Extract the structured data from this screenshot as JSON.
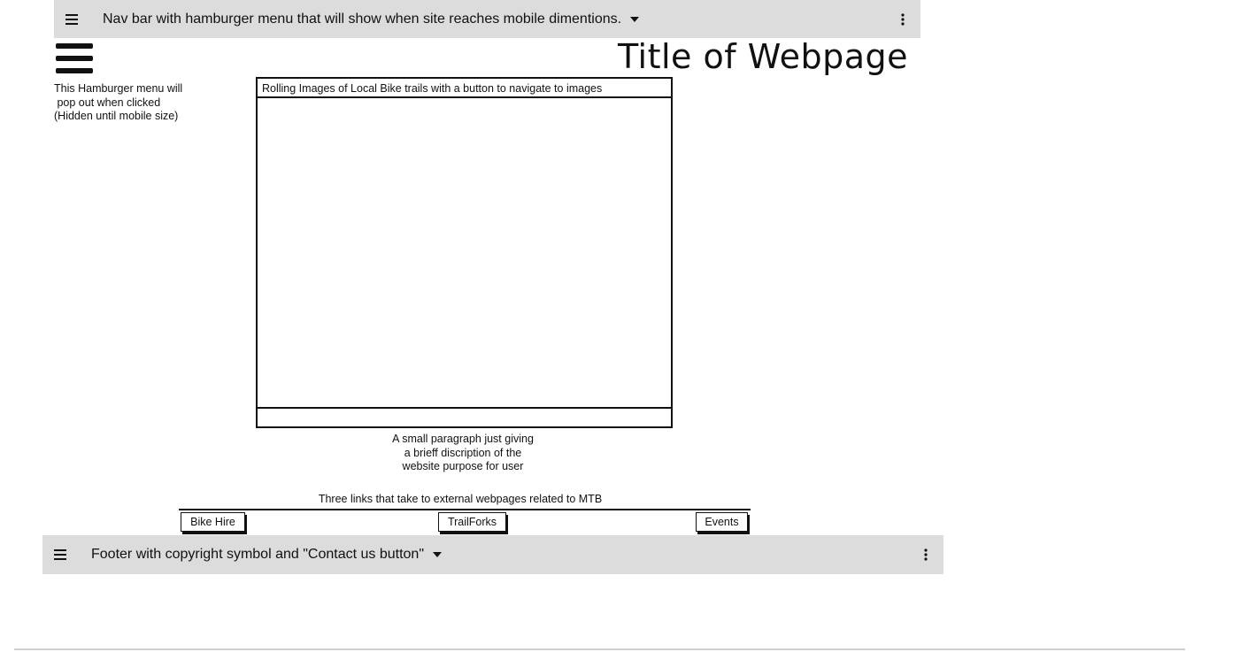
{
  "nav": {
    "label": "Nav bar with hamburger menu that will show when site reaches mobile dimentions."
  },
  "header": {
    "title": "Title of Webpage"
  },
  "hamburger_note": "This Hamburger menu will\n pop out when clicked\n(Hidden until mobile size)",
  "carousel": {
    "header": "Rolling Images of Local Bike trails with a button to navigate to images"
  },
  "description": "A small paragraph just giving\na brieff discription of the\nwebsite purpose for user",
  "links": {
    "label": "Three links that take to external webpages related to MTB",
    "buttons": [
      "Bike Hire",
      "TrailForks",
      "Events"
    ]
  },
  "footer": {
    "label": "Footer with copyright symbol and \"Contact us button\""
  },
  "icons": {
    "menu": "hamburger-icon",
    "dropdown": "caret-down-icon",
    "more": "kebab-icon"
  },
  "colors": {
    "bar_background": "#dcdcdc",
    "ink": "#111111"
  }
}
